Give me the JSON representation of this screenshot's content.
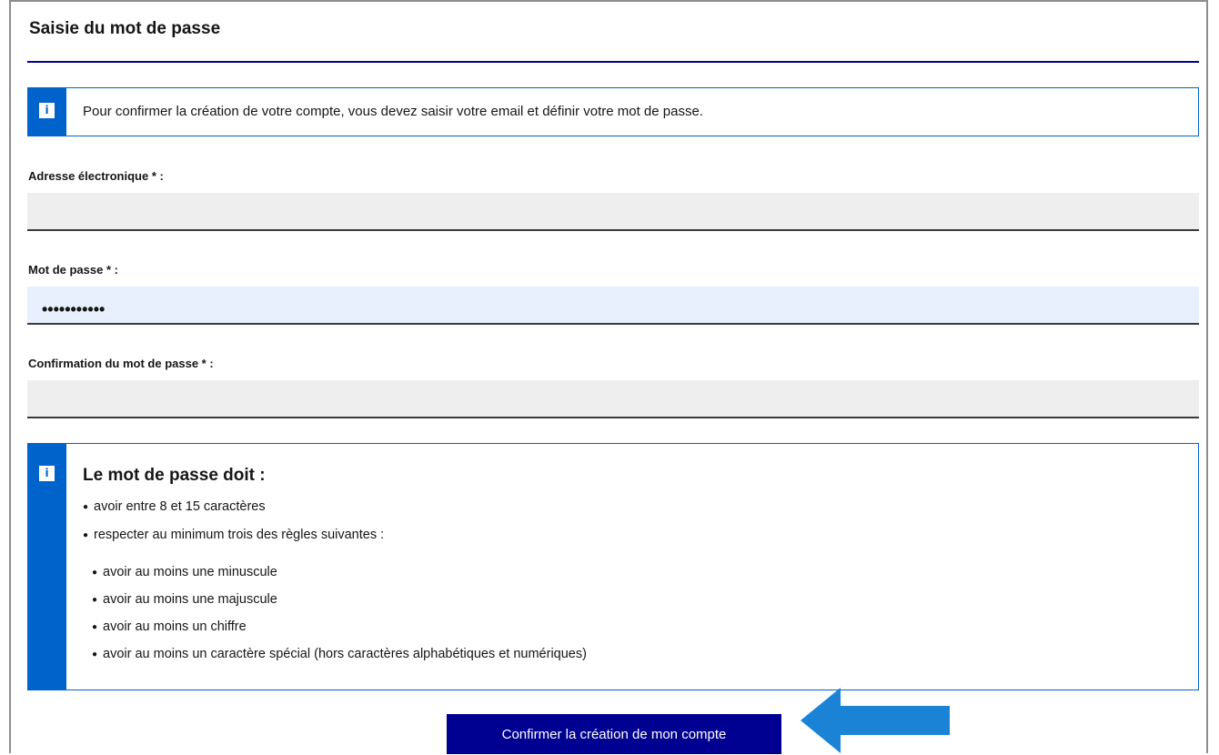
{
  "page": {
    "title": "Saisie du mot de passe"
  },
  "info": {
    "icon": "info-icon",
    "text": "Pour confirmer la création de votre compte, vous devez saisir votre email et définir votre mot de passe."
  },
  "fields": {
    "email": {
      "label": "Adresse électronique * :",
      "value": ""
    },
    "password": {
      "label": "Mot de passe * :",
      "value_masked": "•••••••••••"
    },
    "confirm": {
      "label": "Confirmation du mot de passe * :",
      "value": ""
    }
  },
  "rules": {
    "icon": "info-icon",
    "title": "Le mot de passe doit :",
    "items": [
      "avoir entre 8 et 15 caractères",
      "respecter au minimum trois des règles suivantes :"
    ],
    "subitems": [
      "avoir au moins une minuscule",
      "avoir au moins une majuscule",
      "avoir au moins un chiffre",
      "avoir au moins un caractère spécial (hors caractères alphabétiques et numériques)"
    ]
  },
  "actions": {
    "confirm_label": "Confirmer la création de mon compte"
  },
  "colors": {
    "primary": "#000091",
    "info_blue": "#0063cb",
    "arrow_blue": "#1a83d6",
    "input_bg": "#eeeeee",
    "autofill_bg": "#e8f0fe"
  }
}
